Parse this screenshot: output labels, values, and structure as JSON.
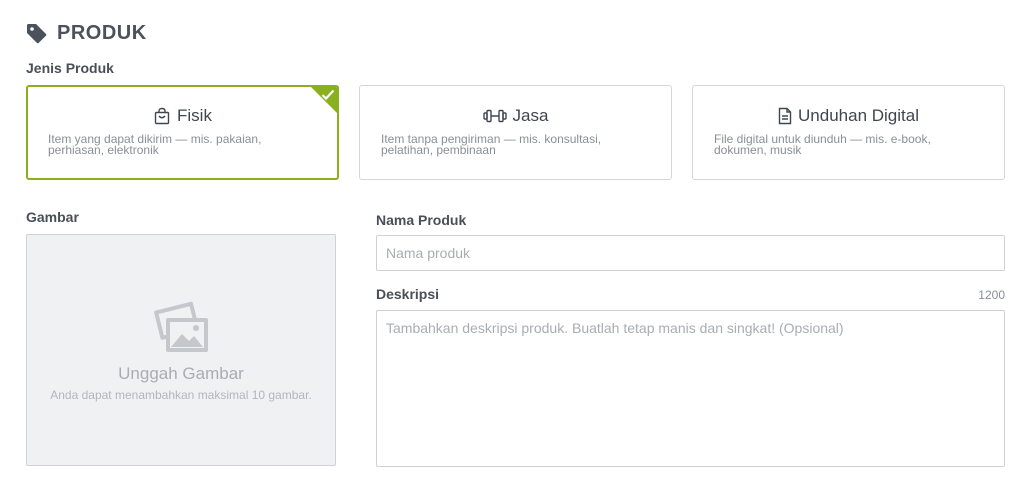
{
  "section": {
    "title": "PRODUK",
    "icon": "tag-icon"
  },
  "product_type": {
    "label": "Jenis Produk",
    "selected": "fisik",
    "cards": [
      {
        "id": "fisik",
        "icon": "shopping-bag-icon",
        "title": "Fisik",
        "description": "Item yang dapat dikirim — mis. pakaian, perhiasan, elektronik"
      },
      {
        "id": "jasa",
        "icon": "dumbbell-icon",
        "title": "Jasa",
        "description": "Item tanpa pengiriman — mis. konsultasi, pelatihan, pembinaan"
      },
      {
        "id": "digital",
        "icon": "file-icon",
        "title": "Unduhan Digital",
        "description": "File digital untuk diunduh — mis. e-book, dokumen, musik"
      }
    ]
  },
  "image": {
    "label": "Gambar",
    "upload_title": "Unggah Gambar",
    "upload_hint": "Anda dapat menambahkan maksimal 10 gambar.",
    "icon": "images-icon"
  },
  "name": {
    "label": "Nama Produk",
    "placeholder": "Nama produk",
    "value": ""
  },
  "description": {
    "label": "Deskripsi",
    "counter": "1200",
    "placeholder": "Tambahkan deskripsi produk. Buatlah tetap manis dan singkat! (Opsional)",
    "value": ""
  },
  "colors": {
    "accent": "#8ab01f",
    "border": "#d4d6d9",
    "text": "#4a4f57",
    "muted": "#8a8f96"
  }
}
